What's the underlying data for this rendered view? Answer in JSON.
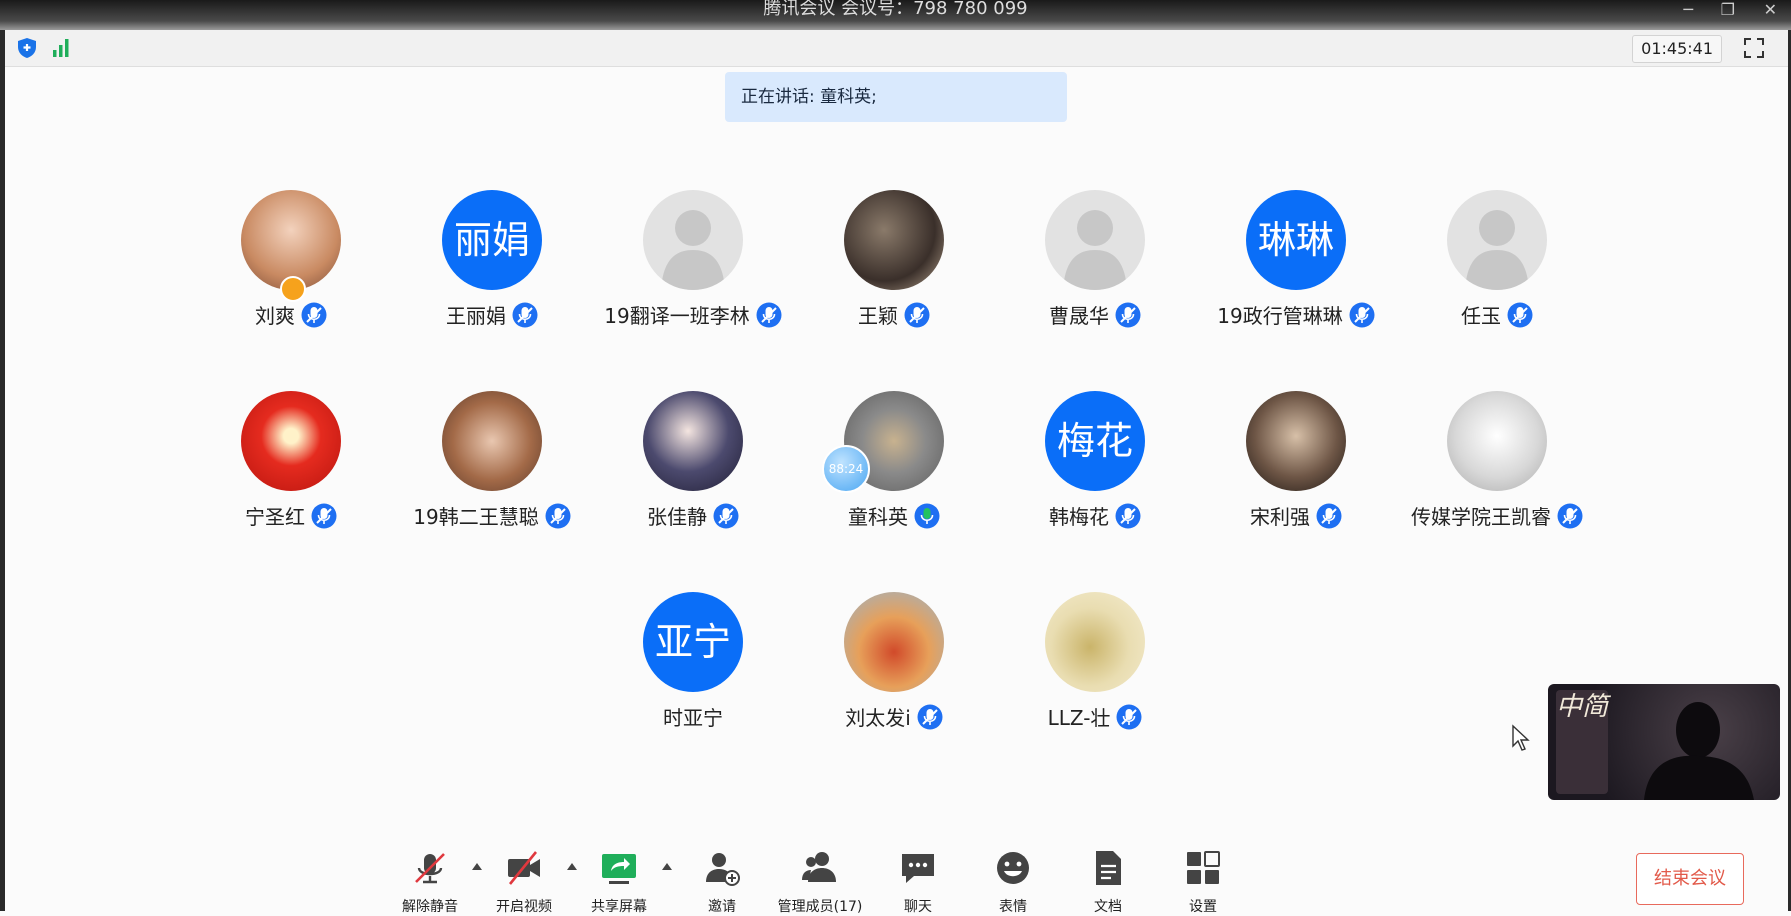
{
  "window": {
    "title": "腾讯会议 会议号：798 780 099"
  },
  "infobar": {
    "timer": "01:45:41"
  },
  "banner": {
    "speaking_text": "正在讲话: 童科英;"
  },
  "participants": [
    {
      "name": "刘爽",
      "avatar": "photo",
      "host": true,
      "mic": "muted"
    },
    {
      "name": "王丽娟",
      "avatar": "initials",
      "initials": "丽娟",
      "mic": "muted"
    },
    {
      "name": "19翻译一班李林",
      "avatar": "blank",
      "mic": "muted"
    },
    {
      "name": "王颖",
      "avatar": "photo",
      "mic": "muted"
    },
    {
      "name": "曹晟华",
      "avatar": "blank",
      "mic": "muted"
    },
    {
      "name": "19政行管琳琳",
      "avatar": "initials",
      "initials": "琳琳",
      "mic": "muted"
    },
    {
      "name": "任玉",
      "avatar": "blank",
      "mic": "muted"
    },
    {
      "name": "宁圣红",
      "avatar": "photo",
      "mic": "muted"
    },
    {
      "name": "19韩二王慧聪",
      "avatar": "photo",
      "mic": "muted"
    },
    {
      "name": "张佳静",
      "avatar": "photo",
      "mic": "muted"
    },
    {
      "name": "童科英",
      "avatar": "photo",
      "mic": "speaking",
      "bubble": "88:24"
    },
    {
      "name": "韩梅花",
      "avatar": "initials",
      "initials": "梅花",
      "mic": "muted"
    },
    {
      "name": "宋利强",
      "avatar": "photo",
      "mic": "muted"
    },
    {
      "name": "传媒学院王凯睿",
      "avatar": "photo",
      "mic": "muted"
    },
    {
      "name": "时亚宁",
      "avatar": "initials",
      "initials": "亚宁",
      "mic": "none"
    },
    {
      "name": "刘太发i",
      "avatar": "photo",
      "mic": "muted"
    },
    {
      "name": "LLZ-壮",
      "avatar": "photo",
      "mic": "muted"
    }
  ],
  "self_video": {
    "tag_text": "中简"
  },
  "toolbar": {
    "unmute": "解除静音",
    "video": "开启视频",
    "share": "共享屏幕",
    "invite": "邀请",
    "members": "管理成员(17)",
    "chat": "聊天",
    "emoji": "表情",
    "docs": "文档",
    "settings": "设置",
    "end": "结束会议"
  },
  "colors": {
    "accent": "#0a6ef8",
    "end": "#e25a4a",
    "banner": "#d9e9fd"
  }
}
